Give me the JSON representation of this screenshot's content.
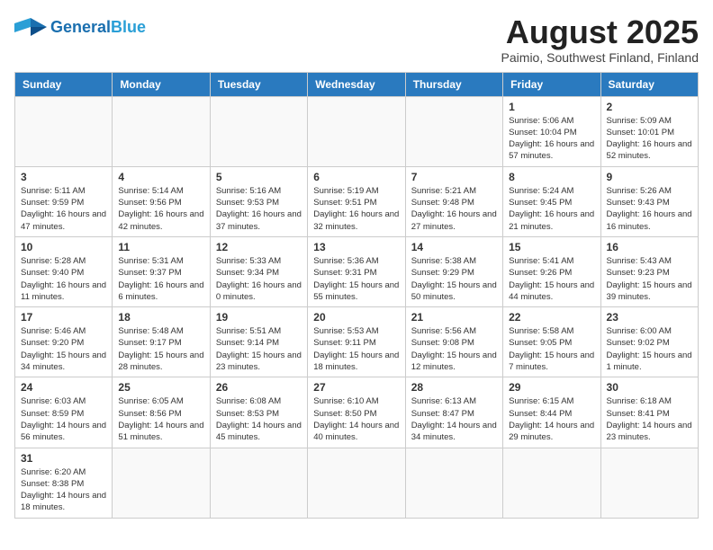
{
  "header": {
    "logo_general": "General",
    "logo_blue": "Blue",
    "title": "August 2025",
    "subtitle": "Paimio, Southwest Finland, Finland"
  },
  "weekdays": [
    "Sunday",
    "Monday",
    "Tuesday",
    "Wednesday",
    "Thursday",
    "Friday",
    "Saturday"
  ],
  "weeks": [
    [
      {
        "day": "",
        "info": ""
      },
      {
        "day": "",
        "info": ""
      },
      {
        "day": "",
        "info": ""
      },
      {
        "day": "",
        "info": ""
      },
      {
        "day": "",
        "info": ""
      },
      {
        "day": "1",
        "info": "Sunrise: 5:06 AM\nSunset: 10:04 PM\nDaylight: 16 hours and 57 minutes."
      },
      {
        "day": "2",
        "info": "Sunrise: 5:09 AM\nSunset: 10:01 PM\nDaylight: 16 hours and 52 minutes."
      }
    ],
    [
      {
        "day": "3",
        "info": "Sunrise: 5:11 AM\nSunset: 9:59 PM\nDaylight: 16 hours and 47 minutes."
      },
      {
        "day": "4",
        "info": "Sunrise: 5:14 AM\nSunset: 9:56 PM\nDaylight: 16 hours and 42 minutes."
      },
      {
        "day": "5",
        "info": "Sunrise: 5:16 AM\nSunset: 9:53 PM\nDaylight: 16 hours and 37 minutes."
      },
      {
        "day": "6",
        "info": "Sunrise: 5:19 AM\nSunset: 9:51 PM\nDaylight: 16 hours and 32 minutes."
      },
      {
        "day": "7",
        "info": "Sunrise: 5:21 AM\nSunset: 9:48 PM\nDaylight: 16 hours and 27 minutes."
      },
      {
        "day": "8",
        "info": "Sunrise: 5:24 AM\nSunset: 9:45 PM\nDaylight: 16 hours and 21 minutes."
      },
      {
        "day": "9",
        "info": "Sunrise: 5:26 AM\nSunset: 9:43 PM\nDaylight: 16 hours and 16 minutes."
      }
    ],
    [
      {
        "day": "10",
        "info": "Sunrise: 5:28 AM\nSunset: 9:40 PM\nDaylight: 16 hours and 11 minutes."
      },
      {
        "day": "11",
        "info": "Sunrise: 5:31 AM\nSunset: 9:37 PM\nDaylight: 16 hours and 6 minutes."
      },
      {
        "day": "12",
        "info": "Sunrise: 5:33 AM\nSunset: 9:34 PM\nDaylight: 16 hours and 0 minutes."
      },
      {
        "day": "13",
        "info": "Sunrise: 5:36 AM\nSunset: 9:31 PM\nDaylight: 15 hours and 55 minutes."
      },
      {
        "day": "14",
        "info": "Sunrise: 5:38 AM\nSunset: 9:29 PM\nDaylight: 15 hours and 50 minutes."
      },
      {
        "day": "15",
        "info": "Sunrise: 5:41 AM\nSunset: 9:26 PM\nDaylight: 15 hours and 44 minutes."
      },
      {
        "day": "16",
        "info": "Sunrise: 5:43 AM\nSunset: 9:23 PM\nDaylight: 15 hours and 39 minutes."
      }
    ],
    [
      {
        "day": "17",
        "info": "Sunrise: 5:46 AM\nSunset: 9:20 PM\nDaylight: 15 hours and 34 minutes."
      },
      {
        "day": "18",
        "info": "Sunrise: 5:48 AM\nSunset: 9:17 PM\nDaylight: 15 hours and 28 minutes."
      },
      {
        "day": "19",
        "info": "Sunrise: 5:51 AM\nSunset: 9:14 PM\nDaylight: 15 hours and 23 minutes."
      },
      {
        "day": "20",
        "info": "Sunrise: 5:53 AM\nSunset: 9:11 PM\nDaylight: 15 hours and 18 minutes."
      },
      {
        "day": "21",
        "info": "Sunrise: 5:56 AM\nSunset: 9:08 PM\nDaylight: 15 hours and 12 minutes."
      },
      {
        "day": "22",
        "info": "Sunrise: 5:58 AM\nSunset: 9:05 PM\nDaylight: 15 hours and 7 minutes."
      },
      {
        "day": "23",
        "info": "Sunrise: 6:00 AM\nSunset: 9:02 PM\nDaylight: 15 hours and 1 minute."
      }
    ],
    [
      {
        "day": "24",
        "info": "Sunrise: 6:03 AM\nSunset: 8:59 PM\nDaylight: 14 hours and 56 minutes."
      },
      {
        "day": "25",
        "info": "Sunrise: 6:05 AM\nSunset: 8:56 PM\nDaylight: 14 hours and 51 minutes."
      },
      {
        "day": "26",
        "info": "Sunrise: 6:08 AM\nSunset: 8:53 PM\nDaylight: 14 hours and 45 minutes."
      },
      {
        "day": "27",
        "info": "Sunrise: 6:10 AM\nSunset: 8:50 PM\nDaylight: 14 hours and 40 minutes."
      },
      {
        "day": "28",
        "info": "Sunrise: 6:13 AM\nSunset: 8:47 PM\nDaylight: 14 hours and 34 minutes."
      },
      {
        "day": "29",
        "info": "Sunrise: 6:15 AM\nSunset: 8:44 PM\nDaylight: 14 hours and 29 minutes."
      },
      {
        "day": "30",
        "info": "Sunrise: 6:18 AM\nSunset: 8:41 PM\nDaylight: 14 hours and 23 minutes."
      }
    ],
    [
      {
        "day": "31",
        "info": "Sunrise: 6:20 AM\nSunset: 8:38 PM\nDaylight: 14 hours and 18 minutes."
      },
      {
        "day": "",
        "info": ""
      },
      {
        "day": "",
        "info": ""
      },
      {
        "day": "",
        "info": ""
      },
      {
        "day": "",
        "info": ""
      },
      {
        "day": "",
        "info": ""
      },
      {
        "day": "",
        "info": ""
      }
    ]
  ]
}
